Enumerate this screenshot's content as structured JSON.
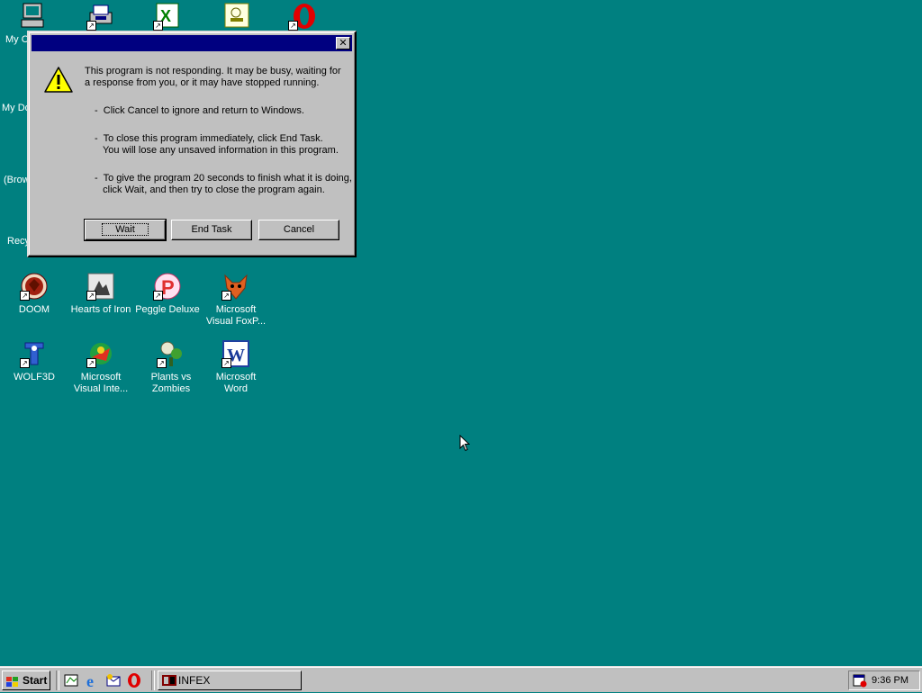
{
  "desktop": {
    "icons": [
      {
        "label": "My C"
      },
      {
        "label": "My Do"
      },
      {
        "label": "(Brow"
      },
      {
        "label": "Recy"
      },
      {
        "label": "DOOM"
      },
      {
        "label": "Hearts of Iron"
      },
      {
        "label": "Peggle Deluxe"
      },
      {
        "label": "Microsoft Visual FoxP..."
      },
      {
        "label": "WOLF3D"
      },
      {
        "label": "Microsoft Visual Inte..."
      },
      {
        "label": "Plants vs Zombies"
      },
      {
        "label": "Microsoft Word"
      }
    ]
  },
  "dialog": {
    "title": "",
    "icon": "warning-icon",
    "message": "This program is not responding. It may be busy, waiting for\na response from you, or it may have stopped running.",
    "bullet1": "-  Click Cancel to ignore and return to Windows.",
    "bullet2": "-  To close this program immediately, click End Task.\n   You will lose any unsaved information in this program.",
    "bullet3": "-  To give the program 20 seconds to finish what it is doing,\n   click Wait, and then try to close the program again.",
    "buttons": {
      "wait": "Wait",
      "end_task": "End Task",
      "cancel": "Cancel"
    }
  },
  "taskbar": {
    "start_label": "Start",
    "task_label": "INFEX",
    "clock": "9:36 PM"
  },
  "colors": {
    "desktop": "#008080",
    "titlebar": "#000080",
    "face": "#c0c0c0"
  }
}
